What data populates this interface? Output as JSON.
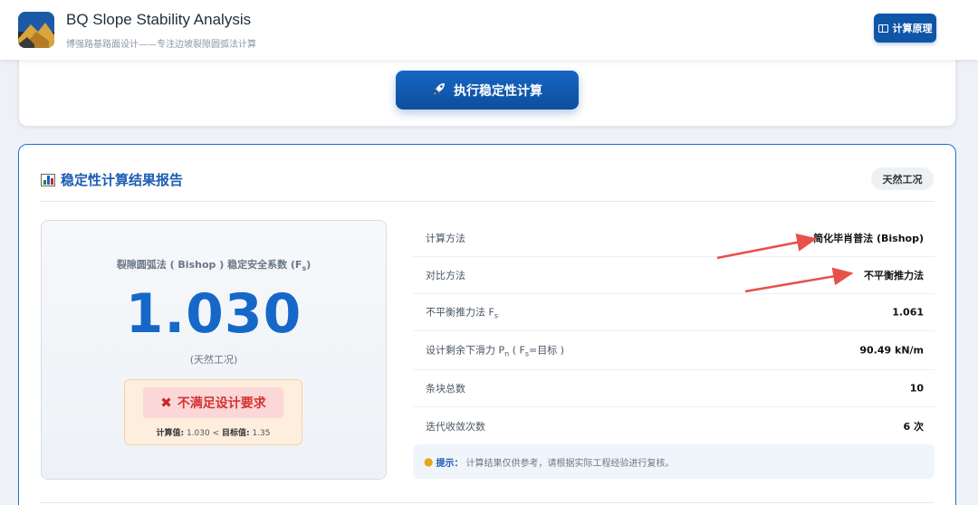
{
  "app": {
    "title": "BQ Slope Stability Analysis",
    "subtitle": "博强路基路面设计——专注边坡裂隙圆弧法计算",
    "principle_button": "计算原理"
  },
  "actions": {
    "run_button": "执行稳定性计算"
  },
  "report": {
    "title": "稳定性计算结果报告",
    "condition_badge": "天然工况",
    "fs_label": "裂隙圆弧法 ( Bishop ) 稳定安全系数 (F",
    "fs_label_sub": "s",
    "fs_label_end": ")",
    "fs_value": "1.030",
    "fs_condition": "(天然工况)",
    "fail_text": "不满足设计要求",
    "fail_detail_label": "计算值:",
    "fail_detail_value": "1.030 < ",
    "target_label": "目标值:",
    "target_value": "1.35",
    "rows": [
      {
        "key": "计算方法",
        "value": "简化毕肖普法 (Bishop)"
      },
      {
        "key": "对比方法",
        "value": "不平衡推力法"
      },
      {
        "key": "不平衡推力法 F",
        "key_sub": "s",
        "value": "1.061"
      },
      {
        "key": "设计剩余下滑力 P",
        "key_sub": "n",
        "key_end": " ( F",
        "key_sub2": "s",
        "key_end2": "=目标 )",
        "value": "90.49 kN/m"
      },
      {
        "key": "条块总数",
        "value": "10"
      },
      {
        "key": "迭代收敛次数",
        "value": "6 次"
      }
    ],
    "tip_label": "提示：",
    "tip_text": "计算结果仅供参考，请根据实际工程经验进行复核。"
  },
  "colors": {
    "accent": "#1668c8",
    "fail_text": "#d63131",
    "arrow": "#e8504a"
  },
  "icons": {
    "principle": "book-icon",
    "run": "rocket-icon",
    "report": "bar-chart-icon",
    "fail": "cross-icon",
    "tip": "lightbulb-icon"
  }
}
